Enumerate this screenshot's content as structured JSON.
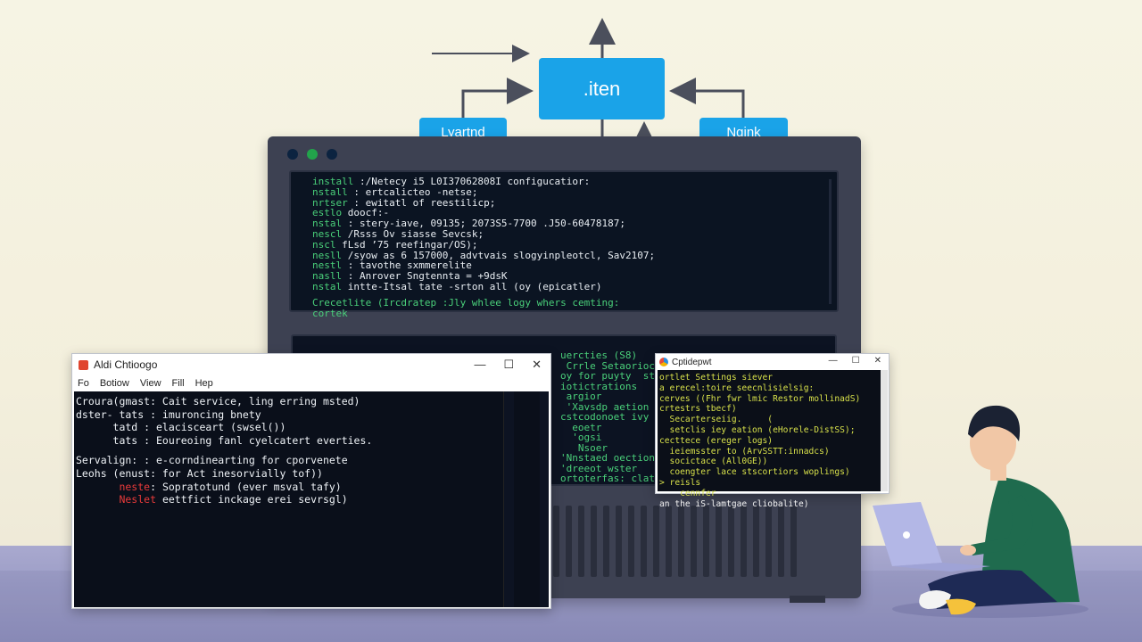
{
  "diagram": {
    "center_label": ".iten",
    "left_label": "Lyartnd",
    "right_label": "Ngink",
    "accent": "#1aa3e8"
  },
  "server": {
    "screen_lines": [
      {
        "cmd": "install",
        "text": ":/Netecy i5 L0I37062808I configucatior:"
      },
      {
        "cmd": "nstall",
        "text": ": ertcalicteo -netse;"
      },
      {
        "cmd": "nrtser",
        "text": ": ewitatl of reestilicp;"
      },
      {
        "cmd": "estlo",
        "text": "doocf:-"
      },
      {
        "cmd": "nstal",
        "text": ": stery-iave, 09135; 2073S5-7700 .J50-60478187;"
      },
      {
        "cmd": "nescl",
        "text": "/Rsss Ov siasse Sevcsk;"
      },
      {
        "cmd": "nscl",
        "text": "fLsd ’75 reefingar/OS);"
      },
      {
        "cmd": "nesll",
        "text": "/syow as 6 157000, advtvais slogyinpleotcl, Sav2107;"
      },
      {
        "cmd": "nestl",
        "text": ": tavothe sxmmerelite"
      },
      {
        "cmd": "nasll",
        "text": ": Anrover Sngtennta = +9dsK"
      },
      {
        "cmd": "nstal",
        "text": "intte-Itsal tate -srton all (oy (epicatler)"
      }
    ],
    "screen_footer": [
      "Crecetlite (Ircdratep :Jly whlee logy whers cemting:",
      "cortek"
    ],
    "panel2_lines": [
      "uercties (S8)",
      " Crrle Setaorioctoa",
      "oy for puyty  stal",
      "iotictrations",
      " argior",
      " 'Xavsdp aetion",
      "cstcodonoet ivy",
      "  eoetr",
      "  'ogsi",
      "   Nsoer",
      "'Nnstaed oection",
      "'dreeot wster",
      "ortoterfas: clat"
    ]
  },
  "left_window": {
    "title": "Aldi Chtioogo",
    "menu": [
      "Fo",
      "Botiow",
      "View",
      "Fill",
      "Hep"
    ],
    "controls": [
      "—",
      "☐",
      "✕"
    ],
    "lines": [
      {
        "prefix": "",
        "text": "Croura(gmast: Cait service, ling erring msted)"
      },
      {
        "prefix": "",
        "text": "dster- tats : imuroncing bnety"
      },
      {
        "prefix": "",
        "text": "      tatd : elacisceart (swsel())"
      },
      {
        "prefix": "",
        "text": "      tats : Eoureoing fanl cyelcatert everties."
      },
      {
        "prefix": "",
        "text": "Servalign: : e-corndinearting for cporvenete"
      },
      {
        "prefix": "",
        "text": "Leohs (enust: for Act inesorvially tof))"
      },
      {
        "prefix": "       neste",
        "text": ": Sopratotund (ever msval tafy)"
      },
      {
        "prefix": "       Neslet",
        "text": " eettfict inckage erei sevrsgl)"
      }
    ]
  },
  "right_window": {
    "title": "Cptidepwt",
    "controls": [
      "—",
      "☐",
      "✕"
    ],
    "lines": [
      {
        "color": "yellow",
        "text": "ortlet Settings siever"
      },
      {
        "color": "yellow",
        "text": "a erecel:toire seecnlisielsig:"
      },
      {
        "color": "yellow",
        "text": "cerves ((Fhr fwr lmic Restor mollinadS)"
      },
      {
        "color": "yellow",
        "text": "crtestrs tbecf)"
      },
      {
        "color": "yellow",
        "text": "  Secarterseiig.     ("
      },
      {
        "color": "yellow",
        "text": "  setclis iey eation (eHorele-DistSS);"
      },
      {
        "color": "yellow",
        "text": "cecttece (ereger logs)"
      },
      {
        "color": "yellow",
        "text": "  ieiemsster to (ArvSSTT:innadcs)"
      },
      {
        "color": "yellow",
        "text": "  socictace (All0GE))"
      },
      {
        "color": "yellow",
        "text": "  coengter lace stscortiors woplings)"
      },
      {
        "color": "yellow",
        "text": "> reisls"
      },
      {
        "color": "yellow",
        "text": "    cennfer"
      },
      {
        "color": "white",
        "text": "an the iS-lamtgae cliobalite)"
      }
    ]
  }
}
